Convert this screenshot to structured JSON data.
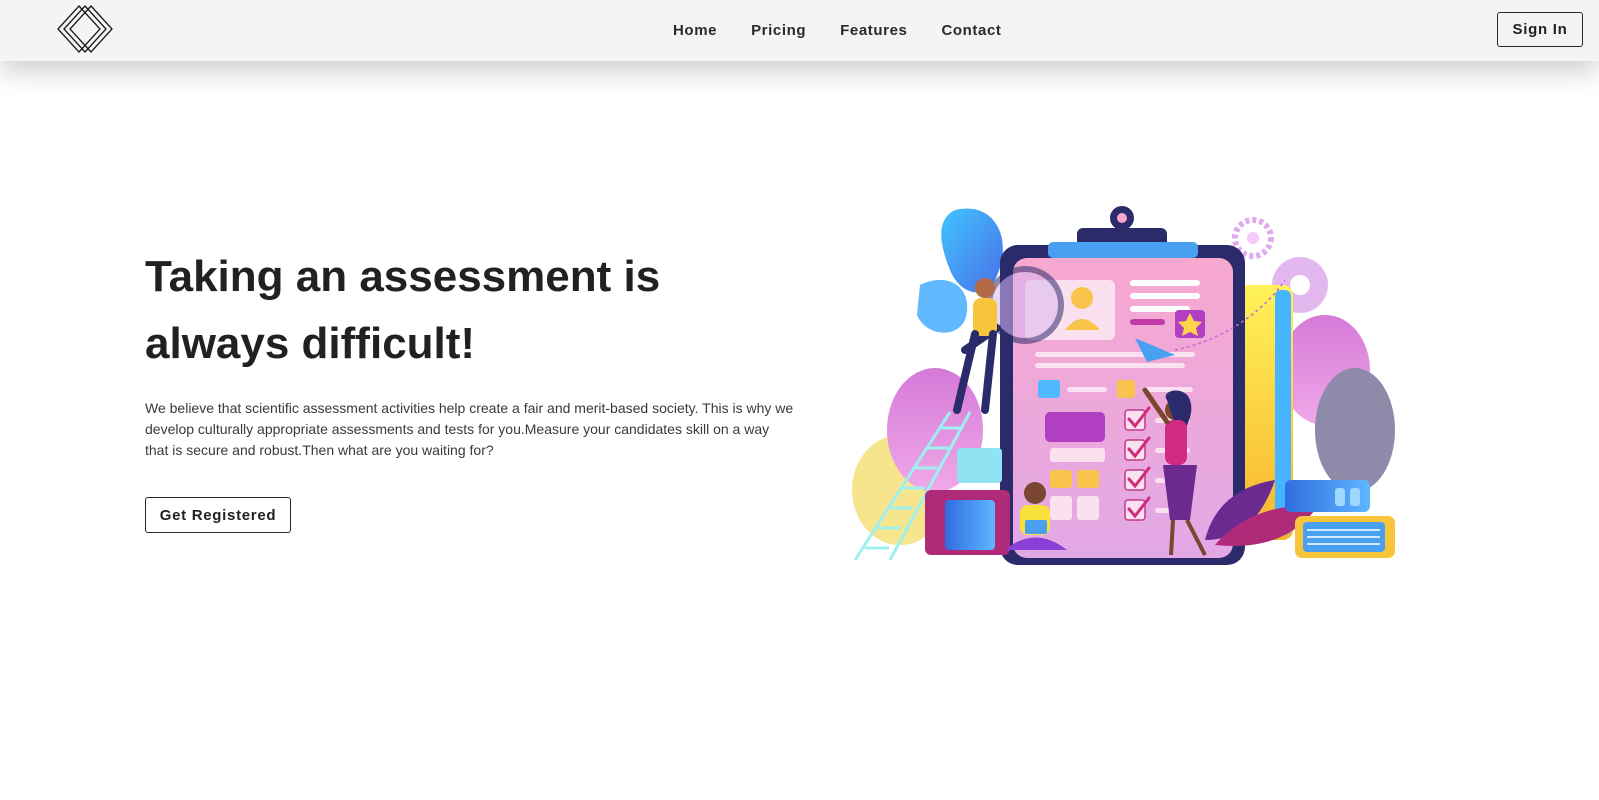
{
  "header": {
    "logo_icon": "diamond-outline-logo",
    "nav": [
      {
        "label": "Home"
      },
      {
        "label": "Pricing"
      },
      {
        "label": "Features"
      },
      {
        "label": "Contact"
      }
    ],
    "signin_label": "Sign In"
  },
  "hero": {
    "title_line1": "Taking an assessment is",
    "title_line2": "always difficult!",
    "description": "We believe that scientific assessment activities help create a fair and merit-based society. This is why we develop culturally appropriate assessments and tests for you.Measure your candidates skill on a way that is secure and robust.Then what are you waiting for?",
    "cta_label": "Get Registered",
    "illustration_icon": "assessment-clipboard-illustration"
  },
  "colors": {
    "nav_bg": "#f4f4f4",
    "text": "#222222",
    "accent_pink": "#e85aa5",
    "accent_purple": "#7b3fc8",
    "accent_blue": "#3aa8f0",
    "accent_yellow": "#f7d64a"
  }
}
